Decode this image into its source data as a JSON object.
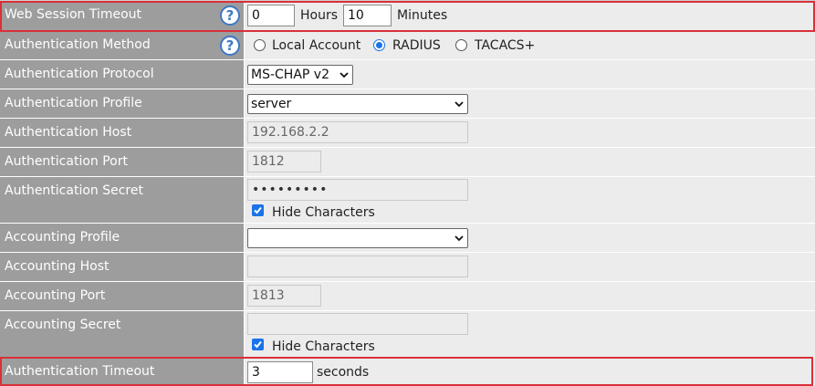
{
  "rows": {
    "web_session_timeout": {
      "label": "Web Session Timeout",
      "hours_value": "0",
      "hours_unit": "Hours",
      "minutes_value": "10",
      "minutes_unit": "Minutes"
    },
    "auth_method": {
      "label": "Authentication Method",
      "options": [
        "Local Account",
        "RADIUS",
        "TACACS+"
      ],
      "selected": "RADIUS"
    },
    "auth_protocol": {
      "label": "Authentication Protocol",
      "selected": "MS-CHAP v2"
    },
    "auth_profile": {
      "label": "Authentication Profile",
      "selected": "server"
    },
    "auth_host": {
      "label": "Authentication Host",
      "value": "192.168.2.2"
    },
    "auth_port": {
      "label": "Authentication Port",
      "value": "1812"
    },
    "auth_secret": {
      "label": "Authentication Secret",
      "value": "•••••••••",
      "hide_label": "Hide Characters",
      "hide_checked": true
    },
    "acct_profile": {
      "label": "Accounting Profile",
      "selected": ""
    },
    "acct_host": {
      "label": "Accounting Host",
      "value": ""
    },
    "acct_port": {
      "label": "Accounting Port",
      "value": "1813"
    },
    "acct_secret": {
      "label": "Accounting Secret",
      "value": "",
      "hide_label": "Hide Characters",
      "hide_checked": true
    },
    "auth_timeout": {
      "label": "Authentication Timeout",
      "value": "3",
      "unit": "seconds"
    }
  },
  "help_icon_glyph": "?",
  "colors": {
    "label_bg": "#9d9d9d",
    "value_bg": "#ececec",
    "highlight": "#d9303a",
    "accent": "#1a73e8",
    "help_icon": "#3f78c4"
  }
}
